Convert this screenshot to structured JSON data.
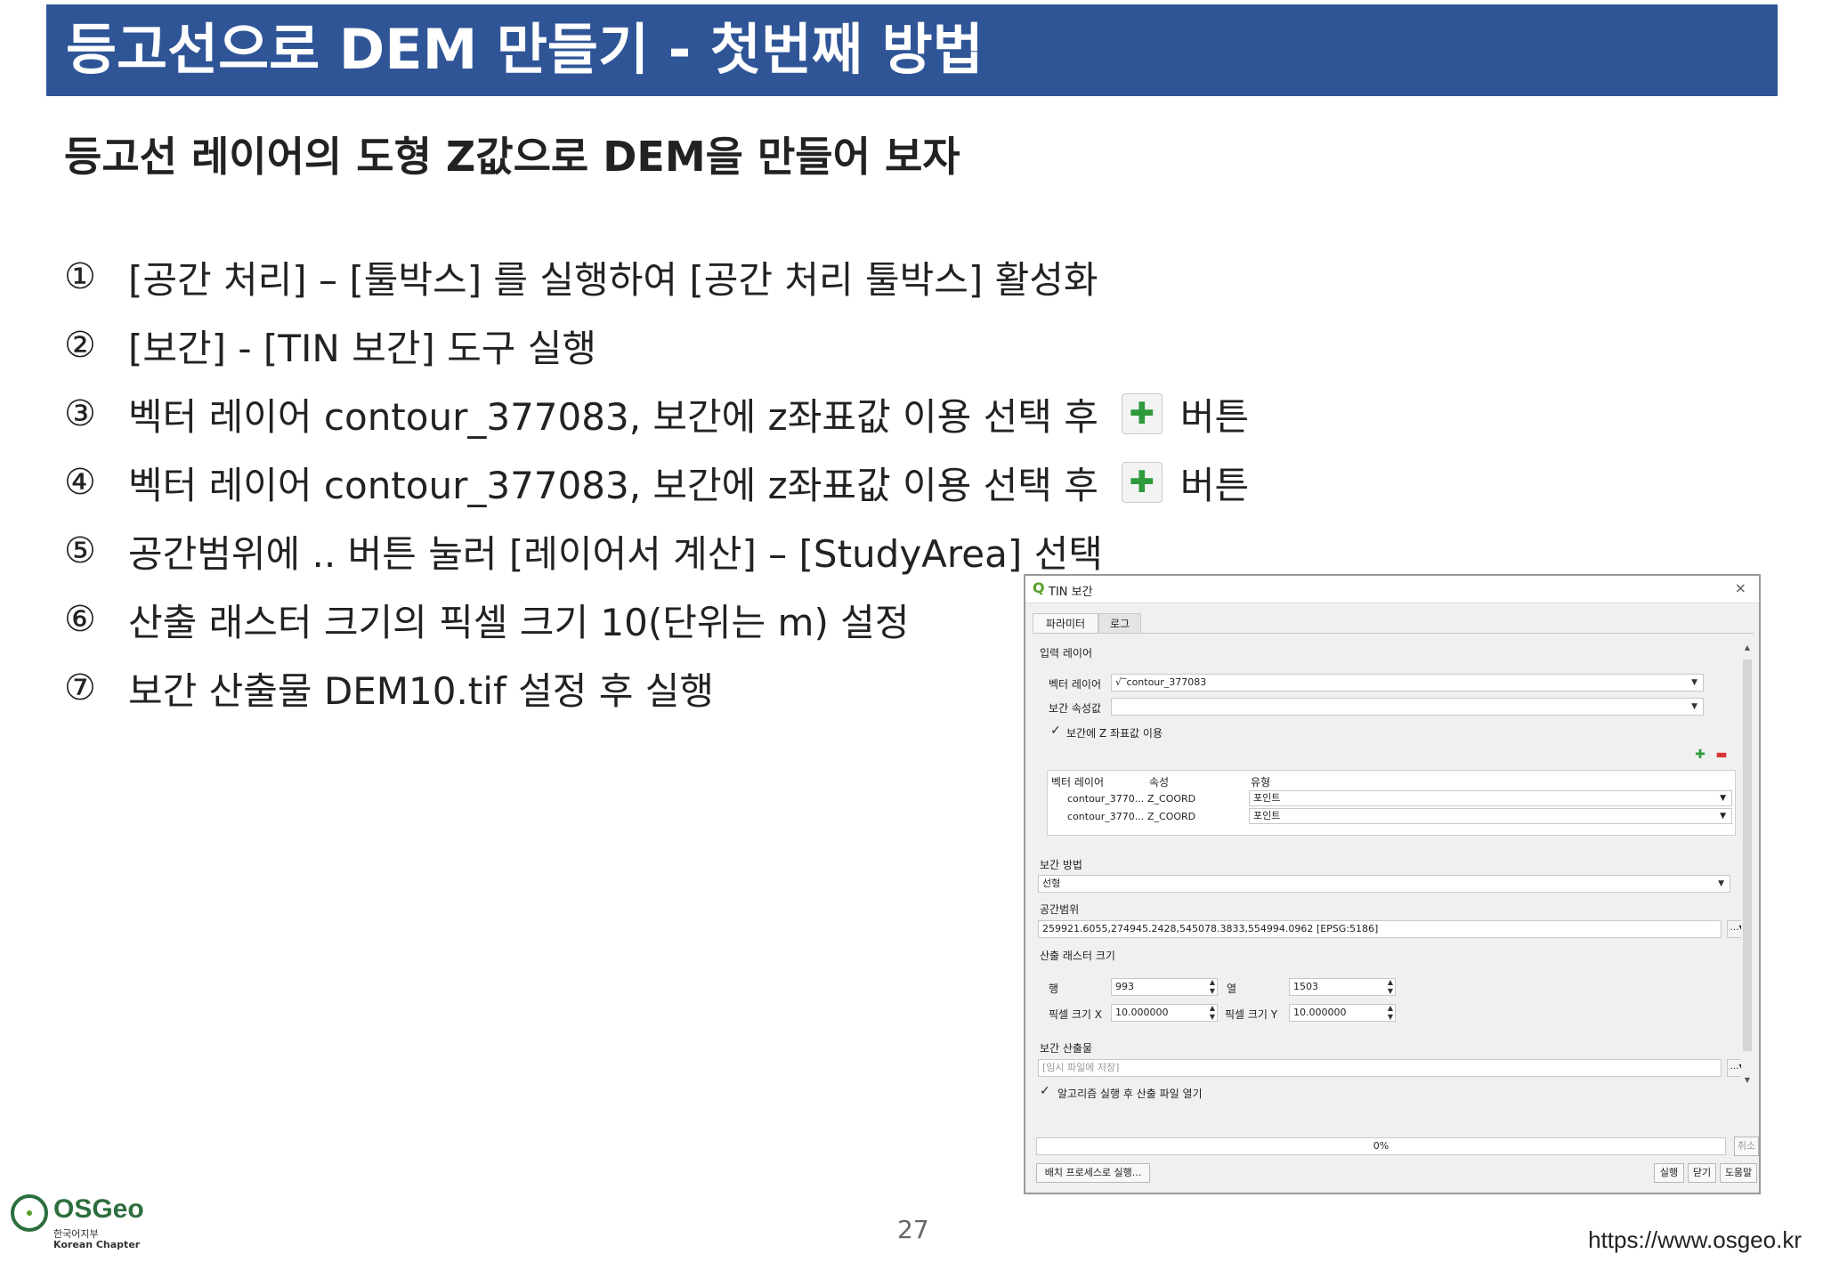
{
  "title": "등고선으로 DEM 만들기 - 첫번째 방법",
  "subtitle": "등고선 레이어의 도형 Z값으로 DEM을 만들어 보자",
  "steps": [
    {
      "num": "①",
      "text": "[공간 처리] – [툴박스] 를 실행하여 [공간 처리 툴박스] 활성화"
    },
    {
      "num": "②",
      "text": "[보간] - [TIN 보간] 도구 실행"
    },
    {
      "num": "③",
      "text": "벡터 레이어 contour_377083, 보간에 z좌표값 이용 선택 후",
      "after": "버튼"
    },
    {
      "num": "④",
      "text": "벡터 레이어 contour_377083, 보간에 z좌표값 이용 선택 후",
      "after": "버튼"
    },
    {
      "num": "⑤",
      "text": "공간범위에 .. 버튼 눌러 [레이어서 계산] – [StudyArea] 선택"
    },
    {
      "num": "⑥",
      "text": "산출 래스터 크기의 픽셀 크기 10(단위는 m) 설정"
    },
    {
      "num": "⑦",
      "text": "보간 산출물 DEM10.tif 설정 후 실행"
    }
  ],
  "icons": {
    "plus": "plus-icon",
    "close": "close-icon",
    "qgis": "qgis-logo-icon"
  },
  "dialog": {
    "title": "TIN 보간",
    "close": "×",
    "tabs": [
      "파라미터",
      "로그"
    ],
    "input_layer_label": "입력 레이어",
    "vector_layer_label": "벡터 레이어",
    "vector_layer_value": "contour_377083",
    "interp_attr_label": "보간 속성값",
    "interp_attr_value": "",
    "use_z_label": "보간에 Z 좌표값 이용",
    "table": {
      "headers": [
        "벡터 레이어",
        "속성",
        "유형"
      ],
      "rows": [
        {
          "layer": "contour_3770...",
          "attr": "Z_COORD",
          "type": "포인트"
        },
        {
          "layer": "contour_3770...",
          "attr": "Z_COORD",
          "type": "포인트"
        }
      ]
    },
    "method_label": "보간 방법",
    "method_value": "선형",
    "extent_label": "공간범위",
    "extent_value": "259921.6055,274945.2428,545078.3833,554994.0962 [EPSG:5186]",
    "raster_size_label": "산출 래스터 크기",
    "rows_label": "행",
    "rows_value": "993",
    "cols_label": "열",
    "cols_value": "1503",
    "pixel_x_label": "픽셀 크기 X",
    "pixel_x_value": "10.000000",
    "pixel_y_label": "픽셀 크기 Y",
    "pixel_y_value": "10.000000",
    "output_label": "보간 산출물",
    "output_placeholder": "[임시 파일에 저장]",
    "open_after_label": "알고리즘 실행 후 산출 파일 열기",
    "progress": "0%",
    "cancel": "취소",
    "batch": "배치 프로세스로 실행...",
    "run": "실행",
    "close_btn": "닫기",
    "help": "도움말"
  },
  "footer": {
    "page": "27",
    "url": "https://www.osgeo.kr",
    "logo_name": "OSGeo",
    "logo_sub1": "한국어지부",
    "logo_sub2": "Korean Chapter"
  }
}
